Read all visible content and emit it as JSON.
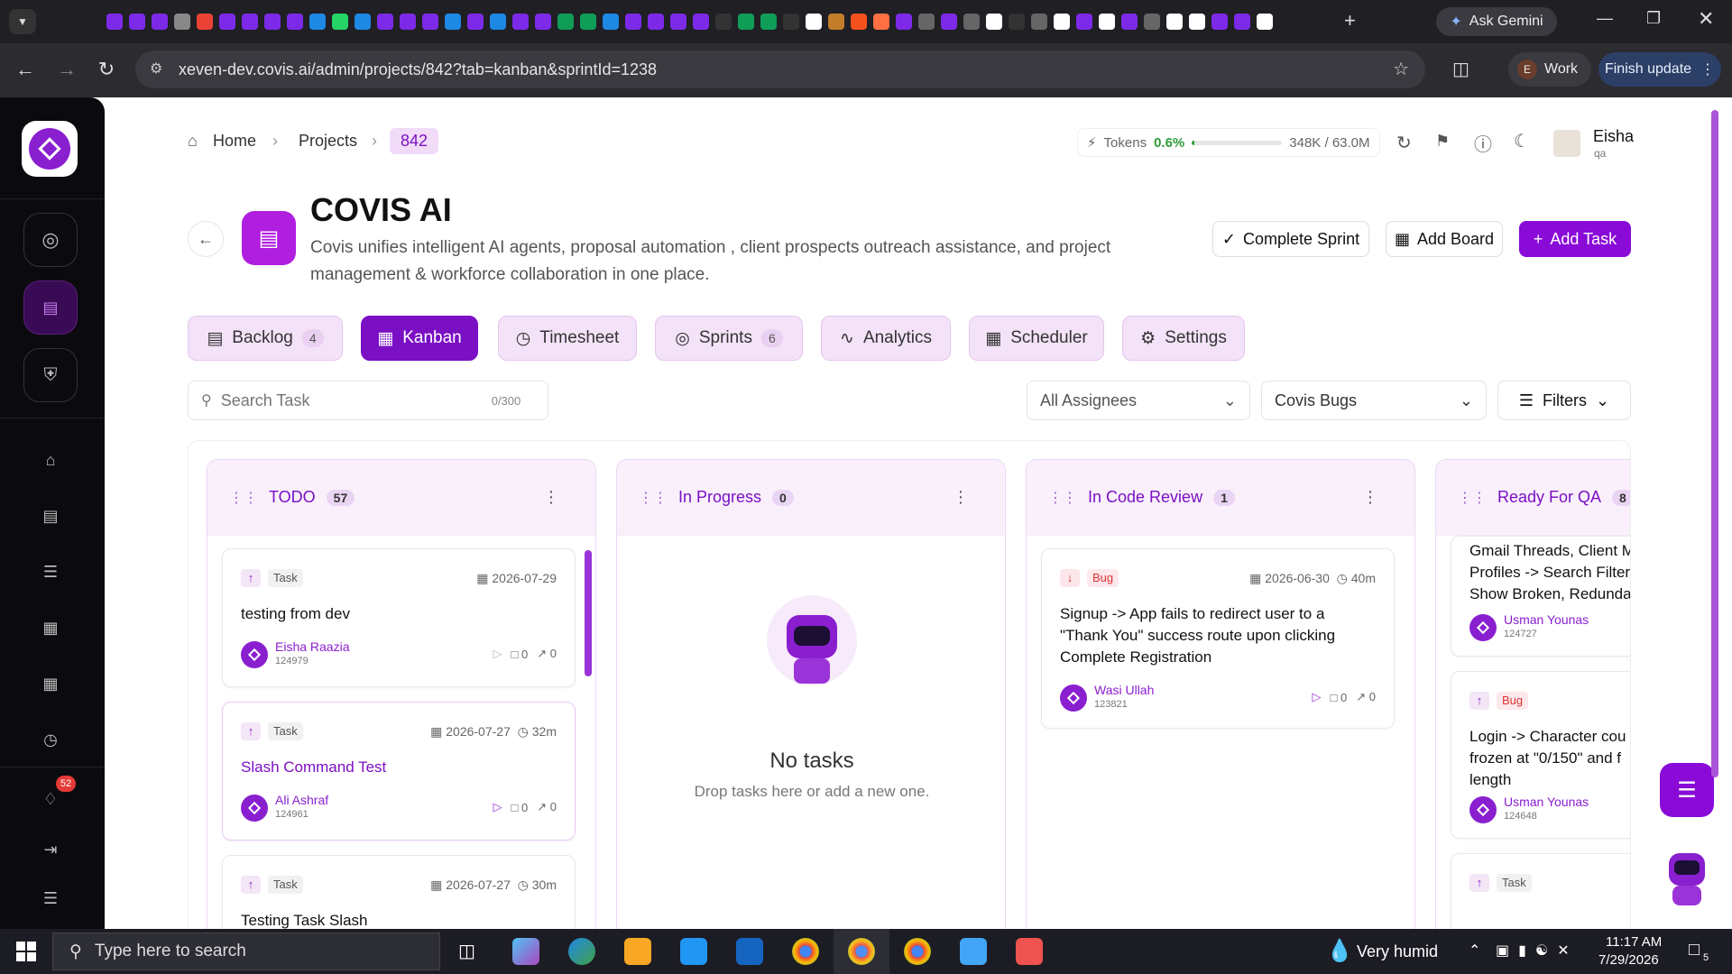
{
  "browser": {
    "ask_gemini": "Ask Gemini",
    "url": "xeven-dev.covis.ai/admin/projects/842?tab=kanban&sprintId=1238",
    "profile_initial": "E",
    "profile_name": "Work",
    "finish_update": "Finish update"
  },
  "breadcrumb": {
    "home": "Home",
    "projects": "Projects",
    "id": "842"
  },
  "tokens": {
    "label": "Tokens",
    "percent": "0.6%",
    "usage": "348K / 63.0M",
    "fill": 0.006
  },
  "user": {
    "name": "Eisha",
    "role": "qa"
  },
  "project": {
    "title": "COVIS AI",
    "description": "Covis unifies intelligent AI agents, proposal automation , client prospects outreach assistance, and project management & workforce collaboration in one place."
  },
  "actions": {
    "complete_sprint": "Complete Sprint",
    "add_board": "Add Board",
    "add_task": "Add Task"
  },
  "tabs": [
    {
      "label": "Backlog",
      "count": "4"
    },
    {
      "label": "Kanban"
    },
    {
      "label": "Timesheet"
    },
    {
      "label": "Sprints",
      "count": "6"
    },
    {
      "label": "Analytics"
    },
    {
      "label": "Scheduler"
    },
    {
      "label": "Settings"
    }
  ],
  "search": {
    "placeholder": "Search Task",
    "counter": "0/300"
  },
  "filters": {
    "assignees": "All Assignees",
    "board": "Covis Bugs",
    "filters_label": "Filters"
  },
  "columns": [
    {
      "title": "TODO",
      "count": "57"
    },
    {
      "title": "In Progress",
      "count": "0"
    },
    {
      "title": "In Code Review",
      "count": "1"
    },
    {
      "title": "Ready For QA",
      "count": "8"
    }
  ],
  "todo_cards": [
    {
      "type": "Task",
      "date": "2026-07-29",
      "title": "testing from dev",
      "user": "Eisha Raazia",
      "user_id": "124979",
      "comments": "0",
      "attachments": "0"
    },
    {
      "type": "Task",
      "date": "2026-07-27",
      "time": "32m",
      "title": "Slash Command Test",
      "user": "Ali Ashraf",
      "user_id": "124961",
      "comments": "0",
      "attachments": "0"
    },
    {
      "type": "Task",
      "date": "2026-07-27",
      "time": "30m",
      "title": "Testing Task Slash"
    }
  ],
  "empty_state": {
    "title": "No tasks",
    "subtitle": "Drop tasks here or add a new one."
  },
  "review_card": {
    "type": "Bug",
    "date": "2026-06-30",
    "time": "40m",
    "title": "Signup -> App fails to redirect user to a \"Thank You\" success route upon clicking Complete Registration",
    "user": "Wasi Ullah",
    "user_id": "123821",
    "comments": "0",
    "attachments": "0"
  },
  "qa_cards": [
    {
      "title": "Gmail Threads, Client M Profiles -> Search Filter Show Broken, Redunda",
      "user": "Usman Younas",
      "user_id": "124727"
    },
    {
      "type": "Bug",
      "title": "Login -> Character cou frozen at \"0/150\" and f length",
      "user": "Usman Younas",
      "user_id": "124648"
    },
    {
      "type": "Task"
    }
  ],
  "sidebar": {
    "notifications": "52"
  },
  "taskbar": {
    "search_placeholder": "Type here to search",
    "weather": "Very humid",
    "time": "11:17 AM",
    "date": "7/29/2026",
    "notif_count": "5"
  },
  "colors": {
    "accent": "#7a0fc4",
    "accent_light": "#f4e2f8",
    "sidebar_bg": "#0b0b0f"
  }
}
